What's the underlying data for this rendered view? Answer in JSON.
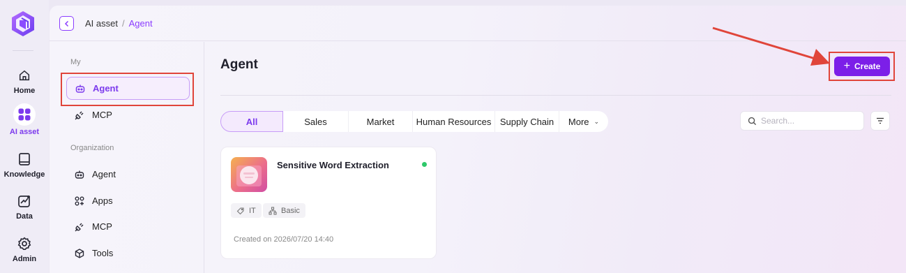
{
  "rail": {
    "items": [
      {
        "label": "Home",
        "icon": "home-icon"
      },
      {
        "label": "AI asset",
        "icon": "grid-icon"
      },
      {
        "label": "Knowledge",
        "icon": "book-icon"
      },
      {
        "label": "Data",
        "icon": "chart-icon"
      },
      {
        "label": "Admin",
        "icon": "gear-icon"
      }
    ],
    "active": "AI asset",
    "accent": "#7c3aed"
  },
  "breadcrumb": {
    "items": [
      "AI asset",
      "Agent"
    ],
    "separator": "/"
  },
  "subnav": {
    "my_label": "My",
    "my_items": [
      {
        "label": "Agent",
        "icon": "robot-icon"
      },
      {
        "label": "MCP",
        "icon": "plug-icon"
      }
    ],
    "org_label": "Organization",
    "org_items": [
      {
        "label": "Agent",
        "icon": "robot-icon"
      },
      {
        "label": "Apps",
        "icon": "apps-icon"
      },
      {
        "label": "MCP",
        "icon": "plug-icon"
      },
      {
        "label": "Tools",
        "icon": "tools-icon"
      }
    ]
  },
  "main": {
    "title": "Agent",
    "create_label": "Create",
    "tabs": [
      "All",
      "Sales",
      "Market",
      "Human Resources",
      "Supply Chain",
      "More"
    ],
    "active_tab": "All",
    "search_placeholder": "Search..."
  },
  "cards": [
    {
      "title": "Sensitive Word Extraction",
      "status_color": "#2ec86a",
      "tags": [
        "IT",
        "Basic"
      ],
      "created": "Created on 2026/07/20 14:40"
    }
  ],
  "colors": {
    "primary": "#7c1fe8",
    "highlight_box": "#e0453a"
  }
}
